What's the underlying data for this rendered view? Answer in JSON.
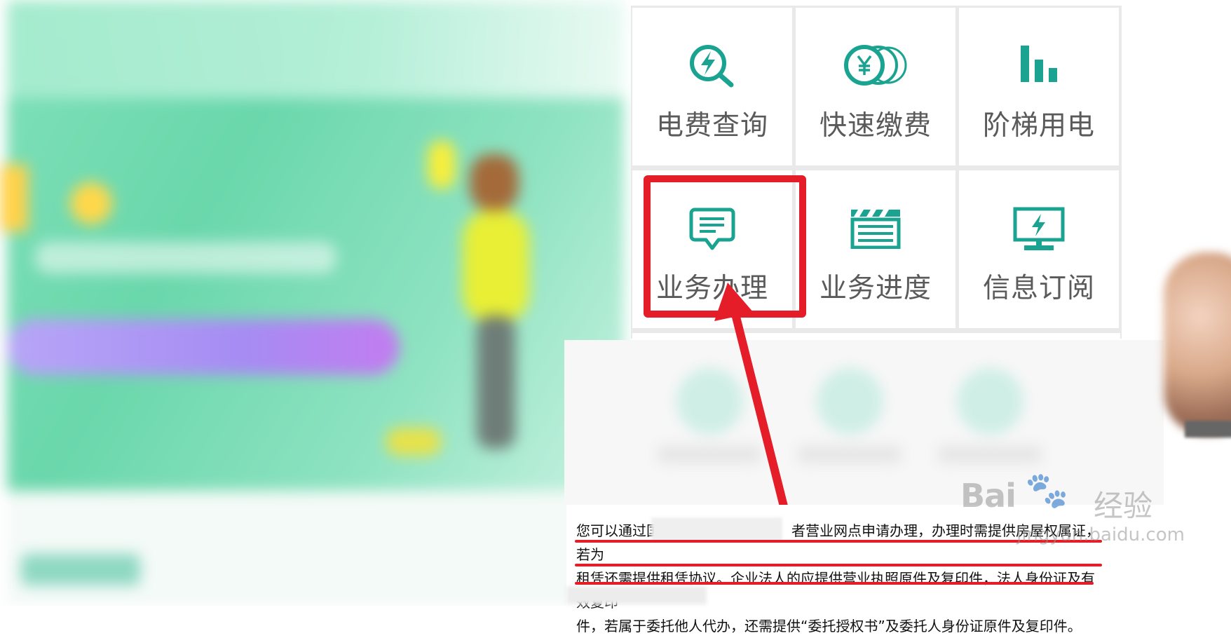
{
  "tiles": [
    {
      "label": "电费查询",
      "icon": "bolt-search-icon"
    },
    {
      "label": "快速缴费",
      "icon": "yen-coins-icon"
    },
    {
      "label": "阶梯用电",
      "icon": "bar-chart-icon"
    },
    {
      "label": "业务办理",
      "icon": "chat-doc-icon"
    },
    {
      "label": "业务进度",
      "icon": "clapperboard-icon"
    },
    {
      "label": "信息订阅",
      "icon": "monitor-bolt-icon"
    }
  ],
  "highlight_color": "#e41d28",
  "accent_color": "#1aa391",
  "instruction": {
    "line1_pre": "您可以通过国",
    "line1_post": "者营业网点申请办理，办理时需提供房屋权属证，若为",
    "line2": "租凭还需提供租凭协议。企业法人的应提供营业执照原件及复印件，法人身份证及有效复印",
    "line3": "件，若属于委托他人代办，还需提供“委托授权书”及委托人身份证原件及复印件。"
  },
  "watermark": {
    "brand": "Bai",
    "paw": "🐾",
    "cn": "经验",
    "url": "jingyan.baidu.com"
  }
}
